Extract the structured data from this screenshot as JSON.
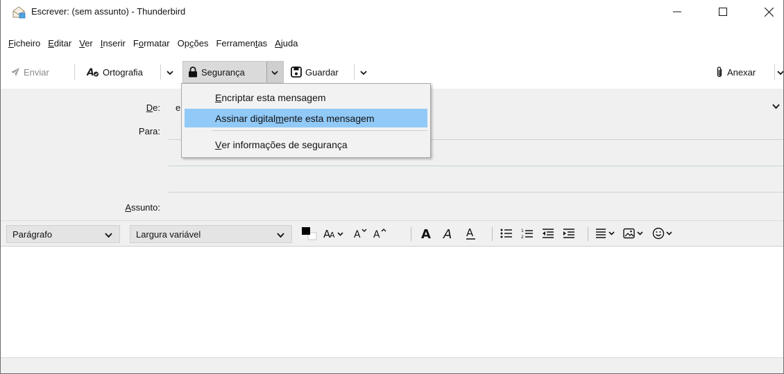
{
  "window": {
    "title": "Escrever: (sem assunto) - Thunderbird",
    "minimize_glyph": "—",
    "maximize_glyph": "☐",
    "close_glyph": "✕"
  },
  "menubar": {
    "items": [
      {
        "pre": "",
        "key": "F",
        "post": "icheiro"
      },
      {
        "pre": "",
        "key": "E",
        "post": "ditar"
      },
      {
        "pre": "",
        "key": "V",
        "post": "er"
      },
      {
        "pre": "",
        "key": "I",
        "post": "nserir"
      },
      {
        "pre": "F",
        "key": "o",
        "post": "rmatar"
      },
      {
        "pre": "Op",
        "key": "ç",
        "post": "ões"
      },
      {
        "pre": "Ferramen",
        "key": "t",
        "post": "as"
      },
      {
        "pre": "",
        "key": "A",
        "post": "juda"
      }
    ]
  },
  "toolbar": {
    "send_label": "Enviar",
    "spelling_label": "Ortografia",
    "security_label": "Segurança",
    "save_label": "Guardar",
    "attach_label": "Anexar"
  },
  "header": {
    "from_label_key": "D",
    "from_label_rest": "e:",
    "from_value": "e",
    "to_label": "Para:",
    "subject_label_key": "A",
    "subject_label_rest": "ssunto:"
  },
  "formatbar": {
    "paragraph_select": "Parágrafo",
    "font_select": "Largura variável"
  },
  "security_menu": {
    "items": [
      {
        "pre": "",
        "key": "E",
        "post": "ncriptar esta mensagem",
        "highlighted": false
      },
      {
        "pre": "Assinar digital",
        "key": "m",
        "post": "ente esta mensagem",
        "highlighted": true
      },
      {
        "pre": "",
        "key": "V",
        "post": "er informações de segurança",
        "highlighted": false
      }
    ]
  },
  "colors": {
    "highlight": "#91c9f7",
    "chrome_bg": "#f0f0f0",
    "line": "#c9d2dc"
  }
}
